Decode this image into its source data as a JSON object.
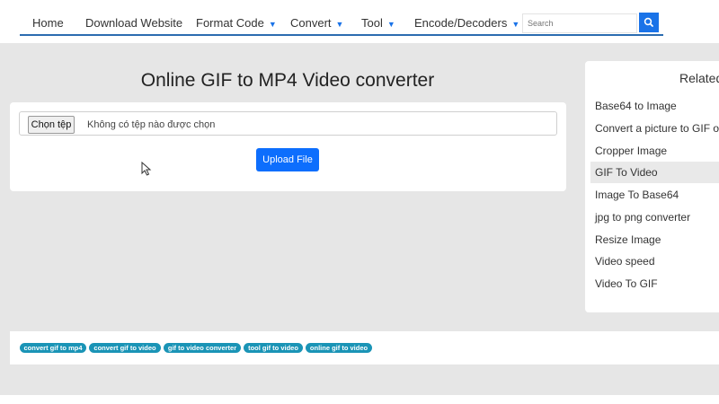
{
  "nav": {
    "home": "Home",
    "download_website": "Download Website",
    "format_code": "Format Code",
    "convert": "Convert",
    "tool": "Tool",
    "encode_decoders": "Encode/Decoders",
    "caret": "▼"
  },
  "search": {
    "placeholder": "Search"
  },
  "main": {
    "title": "Online GIF to MP4 Video converter",
    "file_button": "Chọn tệp",
    "file_status": "Không có tệp nào được chọn",
    "upload_button": "Upload File"
  },
  "sidebar": {
    "title": "Related",
    "items": [
      {
        "label": "Base64 to Image"
      },
      {
        "label": "Convert a picture to GIF online"
      },
      {
        "label": "Cropper Image"
      },
      {
        "label": "GIF To Video"
      },
      {
        "label": "Image To Base64"
      },
      {
        "label": "jpg to png converter"
      },
      {
        "label": "Resize Image"
      },
      {
        "label": "Video speed"
      },
      {
        "label": "Video To GIF"
      }
    ],
    "active_index": 3
  },
  "tags": [
    {
      "label": "convert gif to mp4"
    },
    {
      "label": "convert gif to video"
    },
    {
      "label": "gif to video converter"
    },
    {
      "label": "tool gif to video"
    },
    {
      "label": "online gif to video"
    }
  ],
  "colors": {
    "accent": "#1a73e8",
    "upload_button": "#0d6efd",
    "tag": "#1a94b6",
    "background": "#e6e6e6"
  }
}
